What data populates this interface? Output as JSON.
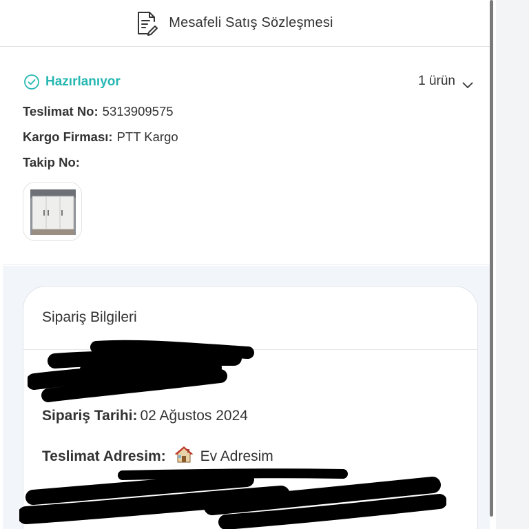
{
  "contract": {
    "label": "Mesafeli Satış Sözleşmesi",
    "icon": "document-edit-icon"
  },
  "shipment": {
    "status": "Hazırlanıyor",
    "status_color": "#26b7b2",
    "item_count": "1 ürün",
    "delivery_no_label": "Teslimat No:",
    "delivery_no": "5313909575",
    "carrier_label": "Kargo Firması:",
    "carrier": "PTT Kargo",
    "tracking_label": "Takip No:",
    "tracking_no": ""
  },
  "order_info": {
    "title": "Sipariş Bilgileri",
    "date_label": "Sipariş Tarihi:",
    "date": "02 Ağustos 2024",
    "address_label": "Teslimat Adresim:",
    "address_name": "Ev Adresim"
  }
}
